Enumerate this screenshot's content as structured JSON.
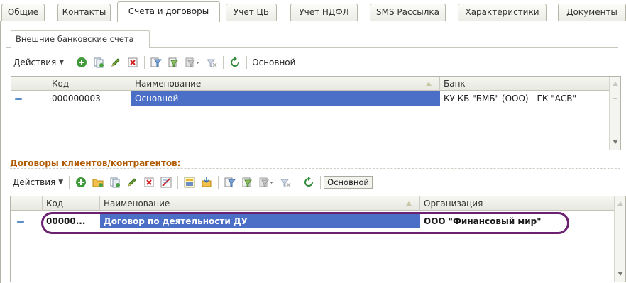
{
  "tabs": [
    {
      "label": "Общие"
    },
    {
      "label": "Контакты"
    },
    {
      "label": "Счета и договоры"
    },
    {
      "label": "Учет ЦБ"
    },
    {
      "label": "Учет НДФЛ"
    },
    {
      "label": "SMS Рассылка"
    },
    {
      "label": "Характеристики"
    },
    {
      "label": "Документы"
    }
  ],
  "bank_accounts": {
    "subtab_label": "Внешние банковские счета",
    "toolbar": {
      "actions_label": "Действия",
      "main_label": "Основной"
    },
    "columns": [
      "Код",
      "Наименование",
      "Банк"
    ],
    "rows": [
      {
        "code": "000000003",
        "name": "Основной",
        "bank": "КУ КБ \"БМБ\" (ООО) - ГК \"АСВ\""
      }
    ]
  },
  "contracts": {
    "section_title": "Договоры клиентов/контрагентов:",
    "toolbar": {
      "actions_label": "Действия",
      "main_label": "Основной"
    },
    "columns": [
      "Код",
      "Наименование",
      "Организация"
    ],
    "rows": [
      {
        "code": "00000...",
        "name": "Договор по деятельности ДУ",
        "organization": "ООО \"Финансовый мир\""
      }
    ]
  },
  "colors": {
    "selection": "#4b6fc7",
    "section_title": "#b05a00",
    "highlight_ring": "#6b2170"
  },
  "icons": [
    "add-icon",
    "copy-icon",
    "edit-icon",
    "delete-icon",
    "filter-icon",
    "filter-list-icon",
    "filter-history-icon",
    "clear-filter-icon",
    "refresh-icon",
    "add-folder-icon",
    "mark-delete-icon",
    "hierarchy-icon",
    "move-to-folder-icon"
  ]
}
